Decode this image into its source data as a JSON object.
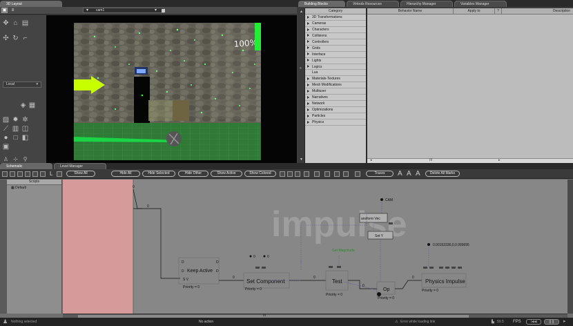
{
  "layout3d": {
    "tab": "3D Layout",
    "camera": "cam1",
    "coord_mode": "Local",
    "wall_text": "100%"
  },
  "building_blocks": {
    "tabs": [
      "Building Blocks",
      "Virtools Resources",
      "Hierarchy Manager",
      "Variables Manager"
    ],
    "category_header": "Category",
    "categories": [
      {
        "label": "3D Transformations",
        "icon": "expand-triangle"
      },
      {
        "label": "Cameras",
        "icon": "expand-triangle"
      },
      {
        "label": "Characters",
        "icon": "expand-triangle"
      },
      {
        "label": "Collisions",
        "icon": "expand-triangle"
      },
      {
        "label": "Controllers",
        "icon": "expand-triangle"
      },
      {
        "label": "Grids",
        "icon": "expand-triangle"
      },
      {
        "label": "Interface",
        "icon": "expand-triangle"
      },
      {
        "label": "Lights",
        "icon": "expand-triangle"
      },
      {
        "label": "Logics",
        "icon": "expand-triangle"
      },
      {
        "label": "Lua",
        "icon": ""
      },
      {
        "label": "Materials-Textures",
        "icon": "expand-triangle"
      },
      {
        "label": "Mesh Modifications",
        "icon": "expand-triangle"
      },
      {
        "label": "Multiuser",
        "icon": "expand-triangle"
      },
      {
        "label": "Narratives",
        "icon": "expand-triangle"
      },
      {
        "label": "Network",
        "icon": "expand-triangle"
      },
      {
        "label": "Optimizations",
        "icon": "expand-triangle"
      },
      {
        "label": "Particles",
        "icon": "expand-triangle"
      },
      {
        "label": "Physics",
        "icon": "expand-triangle"
      }
    ],
    "columns": [
      "Behavior Name",
      "Apply to",
      "?",
      "Description"
    ],
    "scroll_marker": "III"
  },
  "schematic": {
    "tabs": [
      "Schematic",
      "Level Manager"
    ],
    "toolbar": {
      "l_label": "L",
      "buttons": [
        "Show All",
        "Hide All",
        "Hide Selected",
        "Hide Other",
        "Show Active",
        "Show Colored"
      ],
      "traces": "Traces",
      "delete_marks": "Delete All Marks"
    },
    "scripts_header": "Scripts",
    "scripts": [
      "Default"
    ],
    "watermark": "impulse",
    "nodes": {
      "keep_active": {
        "title": "Keep Active",
        "priority": "Priority = 0"
      },
      "set_component": {
        "title": "Set Component",
        "priority": "Priority = 0"
      },
      "test": {
        "title": "Test",
        "priority": "Priority = 0"
      },
      "op": {
        "title": "Op",
        "priority": "Priority = 0"
      },
      "physics_impulse": {
        "title": "Physics Impulse",
        "priority": "Priority = 0"
      },
      "transform_vec": {
        "title": "ansform Vec"
      },
      "set_y": {
        "title": "Set Y"
      }
    },
    "labels": {
      "cam": "CAM",
      "get_magnitude": "Get Magnitude",
      "vec_value": "0.00153336,0,0.999695",
      "zero": "0",
      "sv": "S V"
    },
    "scroll_marker": "III"
  },
  "status_bar": {
    "left": "Nothing selected",
    "action": "No action",
    "error": "Error while loading link",
    "fps_value": "59.5",
    "fps_label": "FPS"
  },
  "colors": {
    "panel": "#3d3d3d",
    "canvas": "#878787",
    "pink_region": "#d69a9a",
    "arrow": "#c8ff00",
    "green": "#3a9a3a"
  }
}
